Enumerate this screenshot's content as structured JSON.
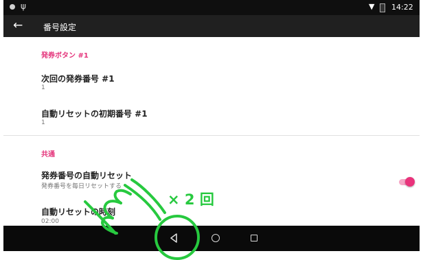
{
  "status_bar": {
    "time": "14:22",
    "usb_icon": "ψ",
    "wifi_icon": "wifi-icon",
    "battery_icon": "battery-icon"
  },
  "app_bar": {
    "back_icon": "←",
    "title": "番号設定"
  },
  "sections": {
    "ticket": {
      "header": "発券ボタン #1",
      "next_number": {
        "title": "次回の発券番号 #1",
        "value": "1"
      },
      "reset_initial": {
        "title": "自動リセットの初期番号 #1",
        "value": "1"
      }
    },
    "common": {
      "header": "共通",
      "auto_reset": {
        "title": "発券番号の自動リセット",
        "summary": "発券番号を毎日リセットする",
        "enabled": true
      },
      "reset_time": {
        "title": "自動リセットの時刻",
        "value": "02:00"
      }
    }
  },
  "nav_bar": {
    "back": "back-triangle-icon",
    "home": "home-circle-icon",
    "recents": "recents-square-icon"
  },
  "annotation": {
    "label": "× 2 回",
    "color": "#27c93f"
  },
  "colors": {
    "accent": "#e4337a",
    "status_bar": "#0f0f0f",
    "app_bar": "#202020"
  }
}
